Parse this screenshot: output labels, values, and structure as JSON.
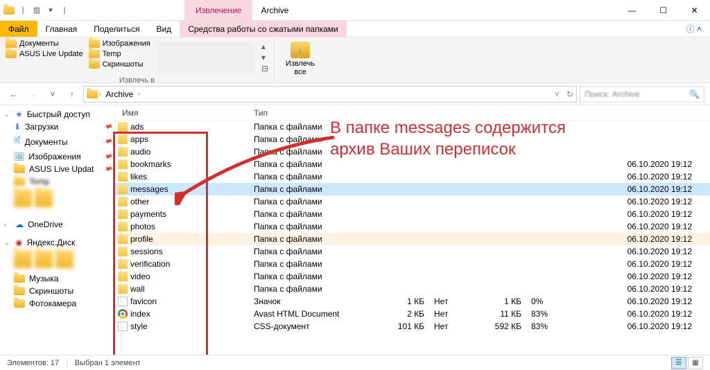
{
  "window": {
    "extract_tab": "Извлечение",
    "title": "Archive",
    "min": "—",
    "max": "☐",
    "close": "✕"
  },
  "ribbon_tabs": {
    "file": "Файл",
    "home": "Главная",
    "share": "Поделиться",
    "view": "Вид",
    "compressed": "Средства работы со сжатыми папками"
  },
  "ribbon": {
    "dests": {
      "docs": "Документы",
      "asus": "ASUS Live Update",
      "images": "Изображения",
      "temp": "Temp",
      "screenshots": "Скриншоты"
    },
    "extract_to_label": "Извлечь в",
    "extract_all": "Извлечь\nвсе"
  },
  "breadcrumb": {
    "item": "Archive",
    "sep": "›"
  },
  "search": {
    "placeholder": "Поиск: Archive"
  },
  "sidebar": {
    "quick": "Быстрый доступ",
    "downloads": "Загрузки",
    "documents": "Документы",
    "images": "Изображения",
    "asus": "ASUS Live Updat",
    "temp": "Temp",
    "onedrive": "OneDrive",
    "yandex": "Яндекс.Диск",
    "music": "Музыка",
    "screenshots": "Скриншоты",
    "camera": "Фотокамера"
  },
  "columns": {
    "name": "Имя",
    "type": "Тип",
    "date": ""
  },
  "files": [
    {
      "name": "ads",
      "type": "Папка с файлами",
      "sz1": "",
      "st1": "",
      "sz2": "",
      "pct": "",
      "date": "",
      "icon": "folder",
      "hidden_date": true
    },
    {
      "name": "apps",
      "type": "Папка с файлами",
      "sz1": "",
      "st1": "",
      "sz2": "",
      "pct": "",
      "date": "",
      "icon": "folder",
      "hidden_date": true
    },
    {
      "name": "audio",
      "type": "Папка с файлами",
      "sz1": "",
      "st1": "",
      "sz2": "",
      "pct": "",
      "date": "",
      "icon": "folder",
      "hidden_date": true
    },
    {
      "name": "bookmarks",
      "type": "Папка с файлами",
      "sz1": "",
      "st1": "",
      "sz2": "",
      "pct": "",
      "date": "06.10.2020 19:12",
      "icon": "folder",
      "partial": true
    },
    {
      "name": "likes",
      "type": "Папка с файлами",
      "sz1": "",
      "st1": "",
      "sz2": "",
      "pct": "",
      "date": "06.10.2020 19:12",
      "icon": "folder"
    },
    {
      "name": "messages",
      "type": "Папка с файлами",
      "sz1": "",
      "st1": "",
      "sz2": "",
      "pct": "",
      "date": "06.10.2020 19:12",
      "icon": "folder",
      "sel": true
    },
    {
      "name": "other",
      "type": "Папка с файлами",
      "sz1": "",
      "st1": "",
      "sz2": "",
      "pct": "",
      "date": "06.10.2020 19:12",
      "icon": "folder"
    },
    {
      "name": "payments",
      "type": "Папка с файлами",
      "sz1": "",
      "st1": "",
      "sz2": "",
      "pct": "",
      "date": "06.10.2020 19:12",
      "icon": "folder"
    },
    {
      "name": "photos",
      "type": "Папка с файлами",
      "sz1": "",
      "st1": "",
      "sz2": "",
      "pct": "",
      "date": "06.10.2020 19:12",
      "icon": "folder"
    },
    {
      "name": "profile",
      "type": "Папка с файлами",
      "sz1": "",
      "st1": "",
      "sz2": "",
      "pct": "",
      "date": "06.10.2020 19:12",
      "icon": "folder",
      "hov": true
    },
    {
      "name": "sessions",
      "type": "Папка с файлами",
      "sz1": "",
      "st1": "",
      "sz2": "",
      "pct": "",
      "date": "06.10.2020 19:12",
      "icon": "folder"
    },
    {
      "name": "verification",
      "type": "Папка с файлами",
      "sz1": "",
      "st1": "",
      "sz2": "",
      "pct": "",
      "date": "06.10.2020 19:12",
      "icon": "folder"
    },
    {
      "name": "video",
      "type": "Папка с файлами",
      "sz1": "",
      "st1": "",
      "sz2": "",
      "pct": "",
      "date": "06.10.2020 19:12",
      "icon": "folder"
    },
    {
      "name": "wall",
      "type": "Папка с файлами",
      "sz1": "",
      "st1": "",
      "sz2": "",
      "pct": "",
      "date": "06.10.2020 19:12",
      "icon": "folder"
    },
    {
      "name": "favicon",
      "type": "Значок",
      "sz1": "1 КБ",
      "st1": "Нет",
      "sz2": "1 КБ",
      "pct": "0%",
      "date": "06.10.2020 19:12",
      "icon": "page"
    },
    {
      "name": "index",
      "type": "Avast HTML Document",
      "sz1": "2 КБ",
      "st1": "Нет",
      "sz2": "11 КБ",
      "pct": "83%",
      "date": "06.10.2020 19:12",
      "icon": "chrome"
    },
    {
      "name": "style",
      "type": "CSS-документ",
      "sz1": "101 КБ",
      "st1": "Нет",
      "sz2": "592 КБ",
      "pct": "83%",
      "date": "06.10.2020 19:12",
      "icon": "page"
    }
  ],
  "status": {
    "count": "Элементов: 17",
    "selected": "Выбран 1 элемент"
  },
  "annotation": {
    "line1": "В папке messages содержится",
    "line2": "архив Ваших переписок"
  }
}
